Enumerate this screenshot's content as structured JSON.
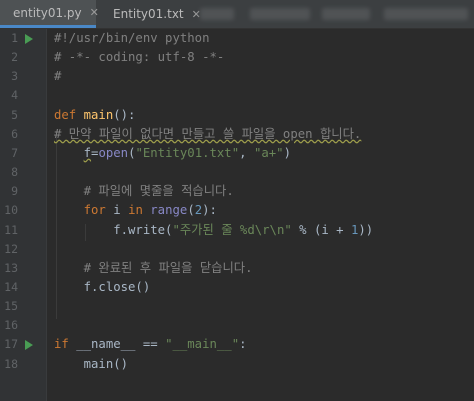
{
  "tabs": [
    {
      "label": "entity01.py",
      "active": true,
      "icon": "python-file-icon"
    },
    {
      "label": "Entity01.txt",
      "active": false,
      "icon": "text-file-icon"
    }
  ],
  "lines": [
    {
      "n": "1",
      "run": true,
      "parts": [
        {
          "t": "#!/usr/bin/env python",
          "c": "cmt"
        }
      ]
    },
    {
      "n": "2",
      "run": false,
      "parts": [
        {
          "t": "# -*- coding: utf-8 -*-",
          "c": "cmt"
        }
      ]
    },
    {
      "n": "3",
      "run": false,
      "parts": [
        {
          "t": "#",
          "c": "cmt"
        }
      ]
    },
    {
      "n": "4",
      "run": false,
      "parts": []
    },
    {
      "n": "5",
      "run": false,
      "parts": [
        {
          "t": "def ",
          "c": "kw"
        },
        {
          "t": "main",
          "c": "fn"
        },
        {
          "t": "():",
          "c": ""
        }
      ]
    },
    {
      "n": "6",
      "run": false,
      "parts": [
        {
          "t": "# 만약 파일이 없다면 만들고 쓸 파일을 open 합니다.",
          "c": "cmt warn"
        }
      ]
    },
    {
      "n": "7",
      "run": false,
      "parts": [
        {
          "t": "    ",
          "c": ""
        },
        {
          "t": "f",
          "c": "warn"
        },
        {
          "t": "=",
          "c": ""
        },
        {
          "t": "open",
          "c": "bi"
        },
        {
          "t": "(",
          "c": ""
        },
        {
          "t": "\"Entity01.txt\"",
          "c": "str"
        },
        {
          "t": ", ",
          "c": ""
        },
        {
          "t": "\"a+\"",
          "c": "str"
        },
        {
          "t": ")",
          "c": ""
        }
      ]
    },
    {
      "n": "8",
      "run": false,
      "parts": []
    },
    {
      "n": "9",
      "run": false,
      "parts": [
        {
          "t": "    # 파일에 몇줄을 적습니다.",
          "c": "cmt"
        }
      ]
    },
    {
      "n": "10",
      "run": false,
      "parts": [
        {
          "t": "    ",
          "c": ""
        },
        {
          "t": "for ",
          "c": "kw"
        },
        {
          "t": "i ",
          "c": ""
        },
        {
          "t": "in ",
          "c": "kw"
        },
        {
          "t": "range",
          "c": "bi"
        },
        {
          "t": "(",
          "c": ""
        },
        {
          "t": "2",
          "c": "num"
        },
        {
          "t": "):",
          "c": ""
        }
      ]
    },
    {
      "n": "11",
      "run": false,
      "parts": [
        {
          "t": "        f.write(",
          "c": ""
        },
        {
          "t": "\"주가된 줄 %d\\r\\n\"",
          "c": "str"
        },
        {
          "t": " % (i + ",
          "c": ""
        },
        {
          "t": "1",
          "c": "num"
        },
        {
          "t": "))",
          "c": ""
        }
      ]
    },
    {
      "n": "12",
      "run": false,
      "parts": []
    },
    {
      "n": "13",
      "run": false,
      "parts": [
        {
          "t": "    # 완료된 후 파일을 닫습니다.",
          "c": "cmt"
        }
      ]
    },
    {
      "n": "14",
      "run": false,
      "parts": [
        {
          "t": "    f.close()",
          "c": ""
        }
      ]
    },
    {
      "n": "15",
      "run": false,
      "parts": []
    },
    {
      "n": "16",
      "run": false,
      "parts": []
    },
    {
      "n": "17",
      "run": true,
      "parts": [
        {
          "t": "if ",
          "c": "kw"
        },
        {
          "t": "__name__ == ",
          "c": ""
        },
        {
          "t": "\"__main__\"",
          "c": "str"
        },
        {
          "t": ":",
          "c": ""
        }
      ]
    },
    {
      "n": "18",
      "run": false,
      "parts": [
        {
          "t": "    main()",
          "c": ""
        }
      ]
    }
  ]
}
